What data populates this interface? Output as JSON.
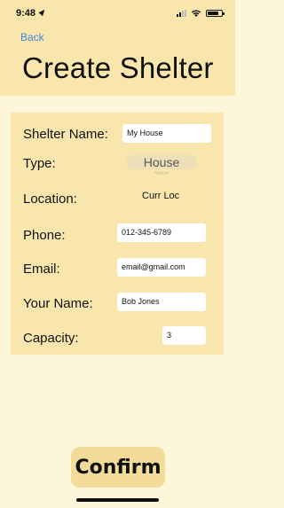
{
  "status_bar": {
    "time": "9:48",
    "battery_level": 0.8
  },
  "nav": {
    "back_label": "Back"
  },
  "page": {
    "title": "Create Shelter"
  },
  "form": {
    "shelter_name": {
      "label": "Shelter Name:",
      "value": "My House"
    },
    "type": {
      "label": "Type:",
      "selected": "House",
      "next_option": "Store"
    },
    "location": {
      "label": "Location:",
      "value": "Curr Loc"
    },
    "phone": {
      "label": "Phone:",
      "value": "012-345-6789"
    },
    "email": {
      "label": "Email:",
      "value": "email@gmail.com"
    },
    "your_name": {
      "label": "Your Name:",
      "value": "Bob Jones"
    },
    "capacity": {
      "label": "Capacity:",
      "value": "3"
    }
  },
  "actions": {
    "confirm_label": "Confirm"
  }
}
